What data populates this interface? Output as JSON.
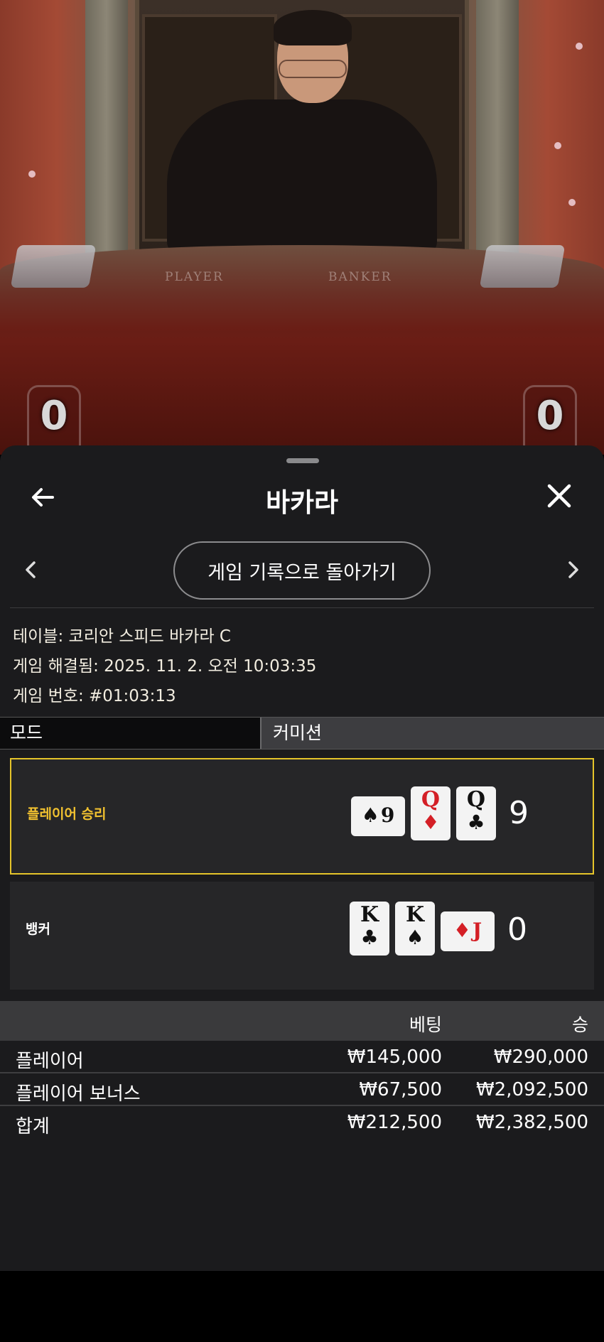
{
  "video": {
    "felt_labels": {
      "player": "PLAYER",
      "banker": "BANKER"
    },
    "scores": {
      "player": "0",
      "banker": "0"
    }
  },
  "sheet": {
    "title": "바카라",
    "back_icon": "arrow-left-icon",
    "close_icon": "close-icon",
    "history_button": "게임 기록으로 돌아가기",
    "info": {
      "table": "테이블: 코리안 스피드 바카라 C",
      "resolved": "게임 해결됨: 2025. 11. 2. 오전 10:03:35",
      "number": "게임 번호: #01:03:13"
    },
    "mode": {
      "label": "모드",
      "value": "커미션"
    },
    "results": {
      "player": {
        "label": "플레이어 승리",
        "total": "9",
        "cards": [
          {
            "rank": "9",
            "suit": "♠",
            "color": "black",
            "orientation": "side"
          },
          {
            "rank": "Q",
            "suit": "♦",
            "color": "red",
            "orientation": "up"
          },
          {
            "rank": "Q",
            "suit": "♣",
            "color": "black",
            "orientation": "up"
          }
        ]
      },
      "banker": {
        "label": "뱅커",
        "total": "0",
        "cards": [
          {
            "rank": "K",
            "suit": "♣",
            "color": "black",
            "orientation": "up"
          },
          {
            "rank": "K",
            "suit": "♠",
            "color": "black",
            "orientation": "up"
          },
          {
            "rank": "J",
            "suit": "♦",
            "color": "red",
            "orientation": "side"
          }
        ]
      }
    },
    "bets": {
      "headers": {
        "bet": "베팅",
        "win": "승"
      },
      "rows": [
        {
          "name": "플레이어",
          "bet": "₩145,000",
          "win": "₩290,000"
        },
        {
          "name": "플레이어 보너스",
          "bet": "₩67,500",
          "win": "₩2,092,500"
        }
      ],
      "total": {
        "name": "합계",
        "bet": "₩212,500",
        "win": "₩2,382,500"
      }
    },
    "colors": {
      "accent_yellow": "#e5c42a",
      "sheet_bg": "#1b1b1d",
      "card_red": "#d41f26"
    }
  }
}
